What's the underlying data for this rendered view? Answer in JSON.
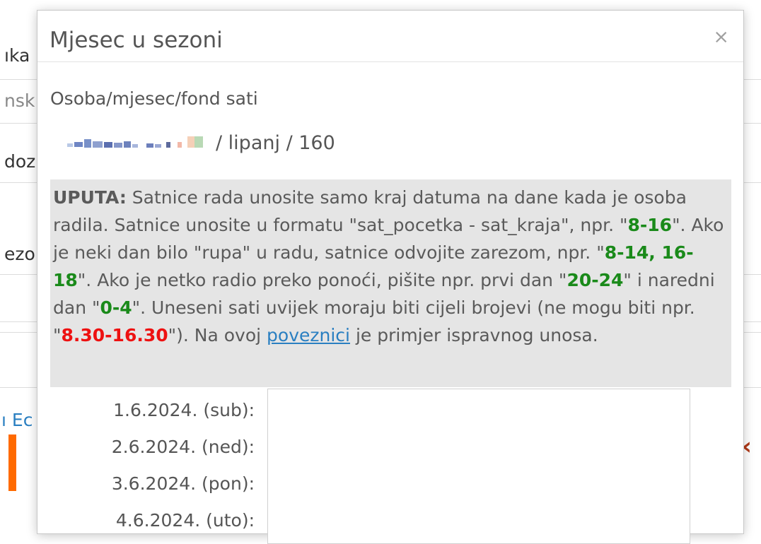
{
  "background": {
    "fragments": [
      "ıka",
      "nsk",
      "doz",
      "ezo",
      "ı Ec"
    ]
  },
  "modal": {
    "title": "Mjesec u sezoni",
    "close_glyph": "×",
    "field_label": "Osoba/mjesec/fond sati",
    "person_suffix": "/ lipanj / 160",
    "instructions": {
      "lead": "UPUTA:",
      "t1": " Satnice rada unosite samo kraj datuma na dane kada je osoba radila. Satnice unosite u formatu \"sat_pocetka - sat_kraja\", npr. \"",
      "ex1": "8-16",
      "t2": "\". Ako je neki dan bilo \"rupa\" u radu, satnice odvojite zarezom, npr. \"",
      "ex2": "8-14, 16-18",
      "t3": "\". Ako je netko radio preko ponoći, pišite npr. prvi dan \"",
      "ex3": "20-24",
      "t4": "\" i naredni dan \"",
      "ex4": "0-4",
      "t5": "\". Uneseni sati uvijek moraju biti cijeli brojevi (ne mogu biti npr. \"",
      "ex_bad": "8.30-16.30",
      "t6": "\"). Na ovoj ",
      "link": "poveznici",
      "t7": " je primjer ispravnog unosa."
    },
    "dates": [
      "1.6.2024. (sub):",
      "2.6.2024. (ned):",
      "3.6.2024. (pon):",
      "4.6.2024. (uto):"
    ],
    "hours_text": ""
  },
  "colors": {
    "accent_green": "#1a8a1a",
    "accent_red": "#ee1111",
    "link_blue": "#2a7fc1",
    "orange": "#ff6a00"
  }
}
